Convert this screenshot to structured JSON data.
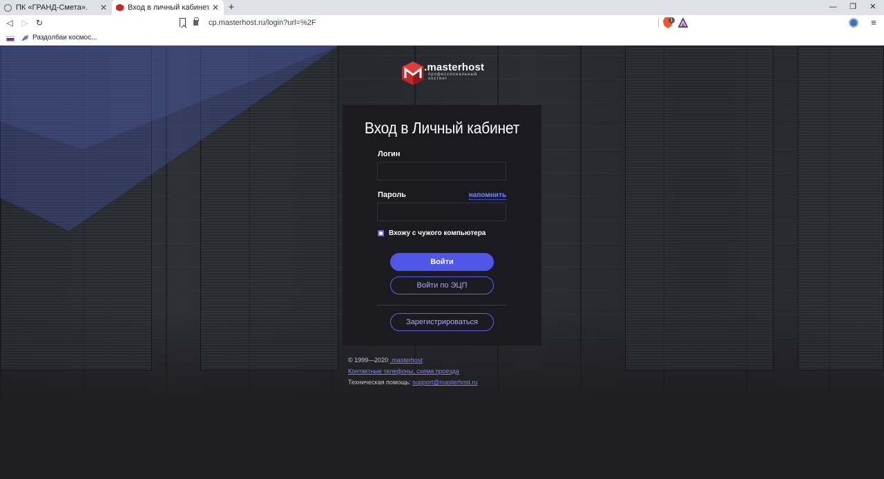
{
  "browser": {
    "tabs": [
      {
        "title": "ПК «ГРАНД-Смета».",
        "active": false
      },
      {
        "title": "Вход в личный кабинет Мастерх",
        "active": true
      }
    ],
    "new_tab": "+",
    "url": "cp.masterhost.ru/login?url=%2F",
    "brave_badge": "1",
    "window_controls": {
      "minimize": "—",
      "maximize": "❐",
      "close": "✕"
    },
    "nav": {
      "back": "◁",
      "forward": "▷",
      "reload": "↻"
    },
    "menu": "≡",
    "bookmarks": [
      {
        "label": "Раздолбаи космос..."
      }
    ]
  },
  "logo": {
    "word": ".masterhost",
    "subtitle": "профессиональный хостинг"
  },
  "login": {
    "title": "Вход в Личный кабинет",
    "login_label": "Логин",
    "login_value": "",
    "password_label": "Пароль",
    "password_value": "",
    "remind_link": "напомнить",
    "foreign_pc_checkbox": "Вхожу с чужого компьютера",
    "foreign_pc_checked": true,
    "submit_button": "Войти",
    "ecp_button": "Войти по ЭЦП",
    "register_button": "Зарегистрироваться"
  },
  "footer": {
    "copyright_prefix": "© 1999—2020",
    "copyright_link": ".masterhost",
    "contacts_link": "Контактные телефоны, схема проезда",
    "support_prefix": "Техническая помощь:",
    "support_email": "support@masterhost.ru"
  },
  "colors": {
    "accent": "#5057e6",
    "link": "#7c86ff",
    "logo_red": "#c62828",
    "card_bg": "#1b1a1f"
  }
}
